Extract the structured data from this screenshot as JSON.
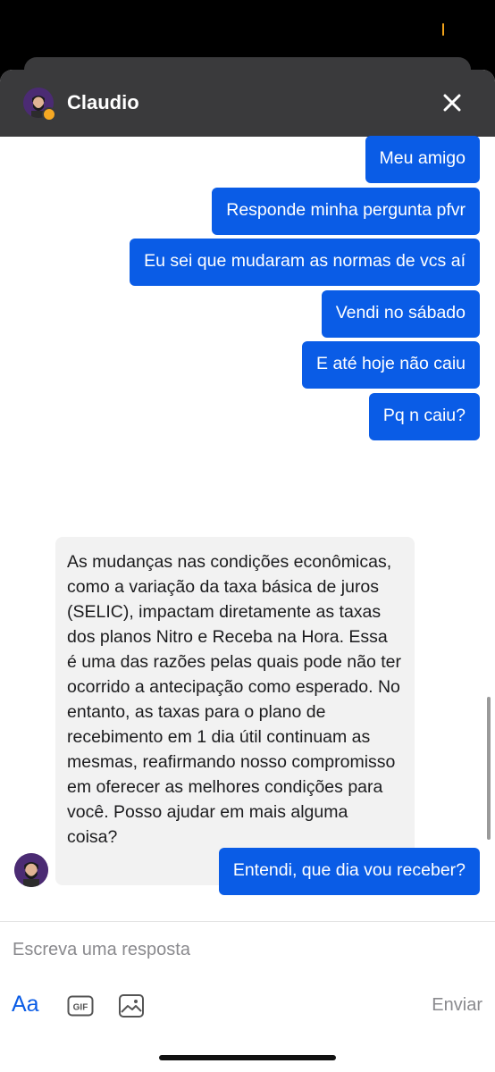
{
  "header": {
    "name": "Claudio"
  },
  "messages_out": [
    "Meu amigo",
    "Responde minha pergunta pfvr",
    "Eu sei que mudaram as normas de vcs aí",
    "Vendi no sábado",
    "E até hoje não caiu",
    "Pq n caiu?"
  ],
  "message_in": "As mudanças nas condições econômicas, como a variação da taxa básica de juros (SELIC), impactam diretamente as taxas dos planos Nitro e Receba na Hora. Essa é uma das razões pelas quais pode não ter ocorrido a antecipação como esperado. No entanto, as taxas para o plano de recebimento em 1 dia útil continuam as mesmas, reafirmando nosso compromisso em oferecer as melhores condições para você. Posso ajudar em mais alguma coisa?",
  "message_last": "Entendi, que dia vou receber?",
  "composer": {
    "placeholder": "Escreva uma resposta",
    "format_label": "Aa",
    "gif_label": "GIF",
    "send_label": "Enviar"
  },
  "colors": {
    "accent": "#0a5ce6",
    "header_bg": "#3a3a3c",
    "status_dot": "#f6a823",
    "incoming_bg": "#f2f2f2"
  },
  "icons": [
    "close-icon",
    "gif-icon",
    "image-icon",
    "avatar-icon"
  ]
}
